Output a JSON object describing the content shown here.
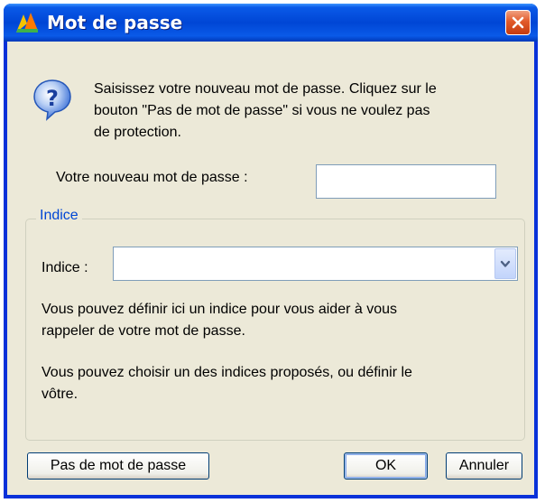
{
  "window": {
    "title": "Mot de passe"
  },
  "dialog": {
    "intro_line1": "Saisissez votre nouveau mot de passe. Cliquez sur le",
    "intro_line2": "bouton \"Pas de mot de passe\" si vous ne voulez pas",
    "intro_line3": "de protection.",
    "password_label": "Votre nouveau mot de passe :",
    "password_value": ""
  },
  "hint_group": {
    "legend": "Indice",
    "hint_label": "Indice  :",
    "hint_value": "",
    "desc1_line1": "Vous pouvez définir ici un indice pour vous aider à vous",
    "desc1_line2": "rappeler de votre mot de passe.",
    "desc2_line1": "Vous pouvez choisir un des indices proposés, ou définir le",
    "desc2_line2": "vôtre."
  },
  "buttons": {
    "no_password": "Pas de mot de passe",
    "ok": "OK",
    "cancel": "Annuler"
  },
  "colors": {
    "titlebar": "#0046d5",
    "dialog_bg": "#ece9d8",
    "group_legend": "#0046d5",
    "close_button": "#e25a2a"
  },
  "icons": {
    "app": "app-icon",
    "close": "close-icon",
    "question": "question-icon",
    "dropdown": "chevron-down-icon"
  }
}
